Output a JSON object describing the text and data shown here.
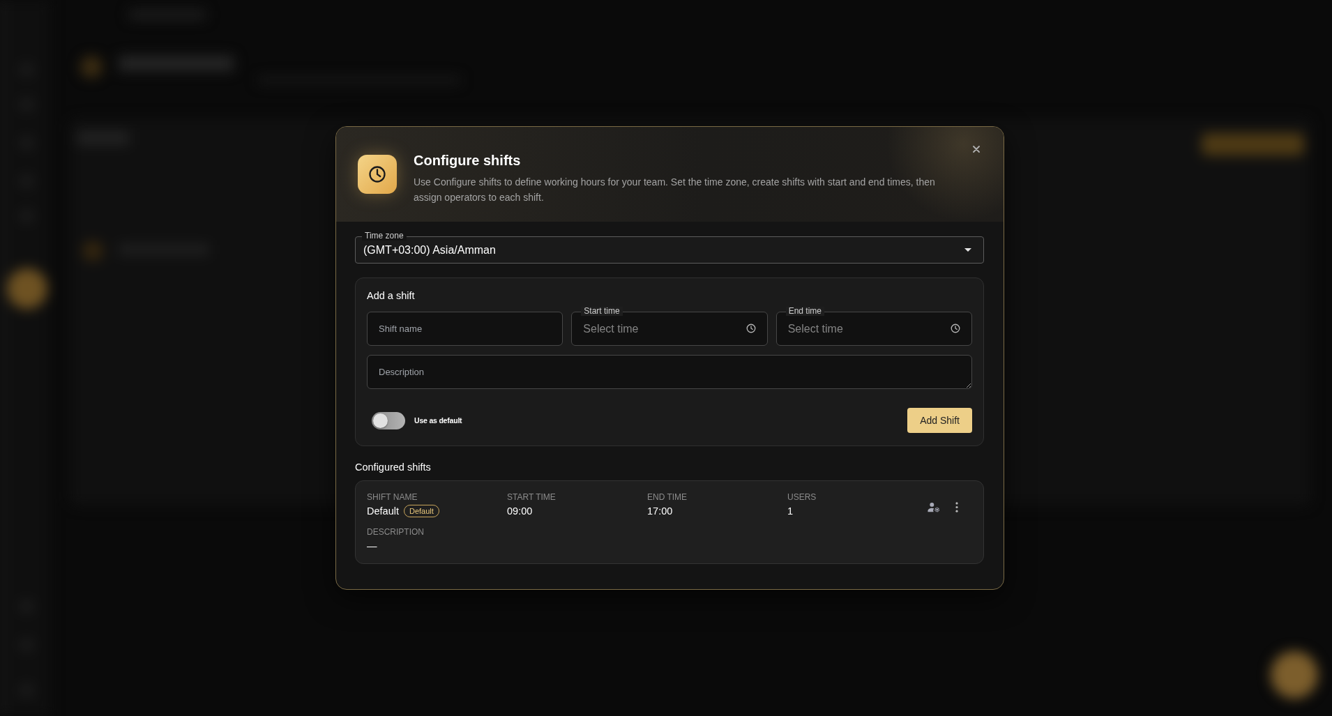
{
  "dialog": {
    "title": "Configure shifts",
    "description": "Use Configure shifts to define working hours for your team. Set the time zone, create shifts with start and end times, then assign operators to each shift."
  },
  "time_zone": {
    "label": "Time zone",
    "value": "(GMT+03:00) Asia/Amman"
  },
  "add_shift": {
    "title": "Add a shift",
    "fields": [
      {
        "kind": "text",
        "placeholder": "Shift name"
      },
      {
        "kind": "time",
        "label": "Start time",
        "placeholder": "Select time"
      },
      {
        "kind": "time",
        "label": "End time",
        "placeholder": "Select time"
      }
    ],
    "description": {
      "placeholder": "Description"
    },
    "use_as_default": {
      "label": "Use as default",
      "on": false
    },
    "button": "Add Shift"
  },
  "configured_shifts": {
    "title": "Configured shifts",
    "shifts": [
      {
        "cells": [
          {
            "label": "SHIFT NAME",
            "value": "Default",
            "badge": "Default"
          },
          {
            "label": "START TIME",
            "value": "09:00"
          },
          {
            "label": "END TIME",
            "value": "17:00"
          },
          {
            "label": "USERS",
            "value": "1"
          }
        ],
        "description_label": "DESCRIPTION",
        "description": "—"
      }
    ]
  }
}
